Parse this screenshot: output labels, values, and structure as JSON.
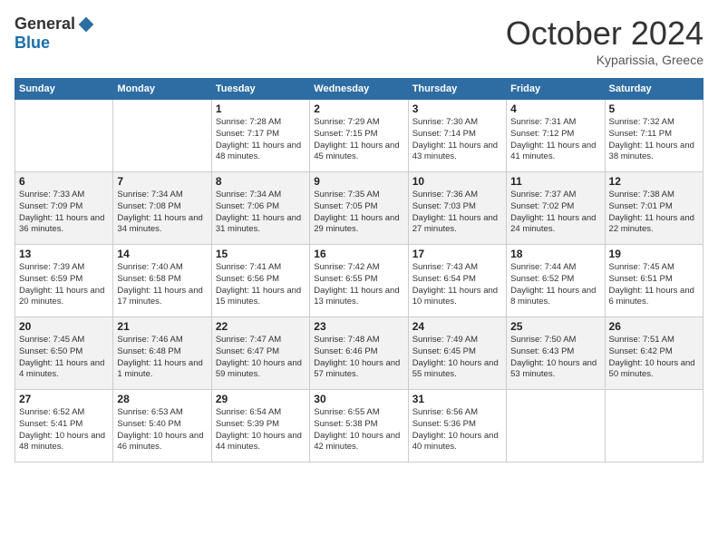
{
  "header": {
    "logo_general": "General",
    "logo_blue": "Blue",
    "month_title": "October 2024",
    "location": "Kyparissia, Greece"
  },
  "days_of_week": [
    "Sunday",
    "Monday",
    "Tuesday",
    "Wednesday",
    "Thursday",
    "Friday",
    "Saturday"
  ],
  "weeks": [
    [
      {
        "day": "",
        "info": ""
      },
      {
        "day": "",
        "info": ""
      },
      {
        "day": "1",
        "info": "Sunrise: 7:28 AM\nSunset: 7:17 PM\nDaylight: 11 hours and 48 minutes."
      },
      {
        "day": "2",
        "info": "Sunrise: 7:29 AM\nSunset: 7:15 PM\nDaylight: 11 hours and 45 minutes."
      },
      {
        "day": "3",
        "info": "Sunrise: 7:30 AM\nSunset: 7:14 PM\nDaylight: 11 hours and 43 minutes."
      },
      {
        "day": "4",
        "info": "Sunrise: 7:31 AM\nSunset: 7:12 PM\nDaylight: 11 hours and 41 minutes."
      },
      {
        "day": "5",
        "info": "Sunrise: 7:32 AM\nSunset: 7:11 PM\nDaylight: 11 hours and 38 minutes."
      }
    ],
    [
      {
        "day": "6",
        "info": "Sunrise: 7:33 AM\nSunset: 7:09 PM\nDaylight: 11 hours and 36 minutes."
      },
      {
        "day": "7",
        "info": "Sunrise: 7:34 AM\nSunset: 7:08 PM\nDaylight: 11 hours and 34 minutes."
      },
      {
        "day": "8",
        "info": "Sunrise: 7:34 AM\nSunset: 7:06 PM\nDaylight: 11 hours and 31 minutes."
      },
      {
        "day": "9",
        "info": "Sunrise: 7:35 AM\nSunset: 7:05 PM\nDaylight: 11 hours and 29 minutes."
      },
      {
        "day": "10",
        "info": "Sunrise: 7:36 AM\nSunset: 7:03 PM\nDaylight: 11 hours and 27 minutes."
      },
      {
        "day": "11",
        "info": "Sunrise: 7:37 AM\nSunset: 7:02 PM\nDaylight: 11 hours and 24 minutes."
      },
      {
        "day": "12",
        "info": "Sunrise: 7:38 AM\nSunset: 7:01 PM\nDaylight: 11 hours and 22 minutes."
      }
    ],
    [
      {
        "day": "13",
        "info": "Sunrise: 7:39 AM\nSunset: 6:59 PM\nDaylight: 11 hours and 20 minutes."
      },
      {
        "day": "14",
        "info": "Sunrise: 7:40 AM\nSunset: 6:58 PM\nDaylight: 11 hours and 17 minutes."
      },
      {
        "day": "15",
        "info": "Sunrise: 7:41 AM\nSunset: 6:56 PM\nDaylight: 11 hours and 15 minutes."
      },
      {
        "day": "16",
        "info": "Sunrise: 7:42 AM\nSunset: 6:55 PM\nDaylight: 11 hours and 13 minutes."
      },
      {
        "day": "17",
        "info": "Sunrise: 7:43 AM\nSunset: 6:54 PM\nDaylight: 11 hours and 10 minutes."
      },
      {
        "day": "18",
        "info": "Sunrise: 7:44 AM\nSunset: 6:52 PM\nDaylight: 11 hours and 8 minutes."
      },
      {
        "day": "19",
        "info": "Sunrise: 7:45 AM\nSunset: 6:51 PM\nDaylight: 11 hours and 6 minutes."
      }
    ],
    [
      {
        "day": "20",
        "info": "Sunrise: 7:45 AM\nSunset: 6:50 PM\nDaylight: 11 hours and 4 minutes."
      },
      {
        "day": "21",
        "info": "Sunrise: 7:46 AM\nSunset: 6:48 PM\nDaylight: 11 hours and 1 minute."
      },
      {
        "day": "22",
        "info": "Sunrise: 7:47 AM\nSunset: 6:47 PM\nDaylight: 10 hours and 59 minutes."
      },
      {
        "day": "23",
        "info": "Sunrise: 7:48 AM\nSunset: 6:46 PM\nDaylight: 10 hours and 57 minutes."
      },
      {
        "day": "24",
        "info": "Sunrise: 7:49 AM\nSunset: 6:45 PM\nDaylight: 10 hours and 55 minutes."
      },
      {
        "day": "25",
        "info": "Sunrise: 7:50 AM\nSunset: 6:43 PM\nDaylight: 10 hours and 53 minutes."
      },
      {
        "day": "26",
        "info": "Sunrise: 7:51 AM\nSunset: 6:42 PM\nDaylight: 10 hours and 50 minutes."
      }
    ],
    [
      {
        "day": "27",
        "info": "Sunrise: 6:52 AM\nSunset: 5:41 PM\nDaylight: 10 hours and 48 minutes."
      },
      {
        "day": "28",
        "info": "Sunrise: 6:53 AM\nSunset: 5:40 PM\nDaylight: 10 hours and 46 minutes."
      },
      {
        "day": "29",
        "info": "Sunrise: 6:54 AM\nSunset: 5:39 PM\nDaylight: 10 hours and 44 minutes."
      },
      {
        "day": "30",
        "info": "Sunrise: 6:55 AM\nSunset: 5:38 PM\nDaylight: 10 hours and 42 minutes."
      },
      {
        "day": "31",
        "info": "Sunrise: 6:56 AM\nSunset: 5:36 PM\nDaylight: 10 hours and 40 minutes."
      },
      {
        "day": "",
        "info": ""
      },
      {
        "day": "",
        "info": ""
      }
    ]
  ]
}
